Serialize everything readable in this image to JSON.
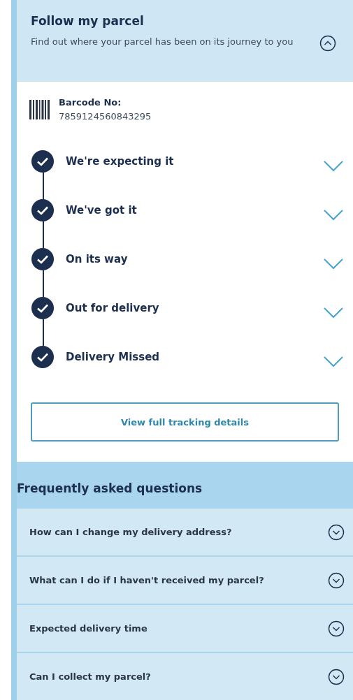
{
  "header": {
    "title": "Follow my parcel",
    "subtitle": "Find out where your parcel has been on its journey to you",
    "expanded": true
  },
  "barcode": {
    "label": "Barcode No:",
    "number": "7859124560843295"
  },
  "steps": [
    {
      "label": "We're expecting it",
      "done": true,
      "expanded": false
    },
    {
      "label": "We've got it",
      "done": true,
      "expanded": false
    },
    {
      "label": "On its way",
      "done": true,
      "expanded": false
    },
    {
      "label": "Out for delivery",
      "done": true,
      "expanded": false
    },
    {
      "label": "Delivery Missed",
      "done": true,
      "expanded": false
    }
  ],
  "tracking_button": "View full tracking details",
  "faq": {
    "title": "Frequently asked questions",
    "items": [
      {
        "question": "How can I change my delivery address?",
        "expanded": false
      },
      {
        "question": "What can I do if I haven't received my parcel?",
        "expanded": false
      },
      {
        "question": "Expected delivery time",
        "expanded": false
      },
      {
        "question": "Can I collect my parcel?",
        "expanded": false
      }
    ]
  }
}
